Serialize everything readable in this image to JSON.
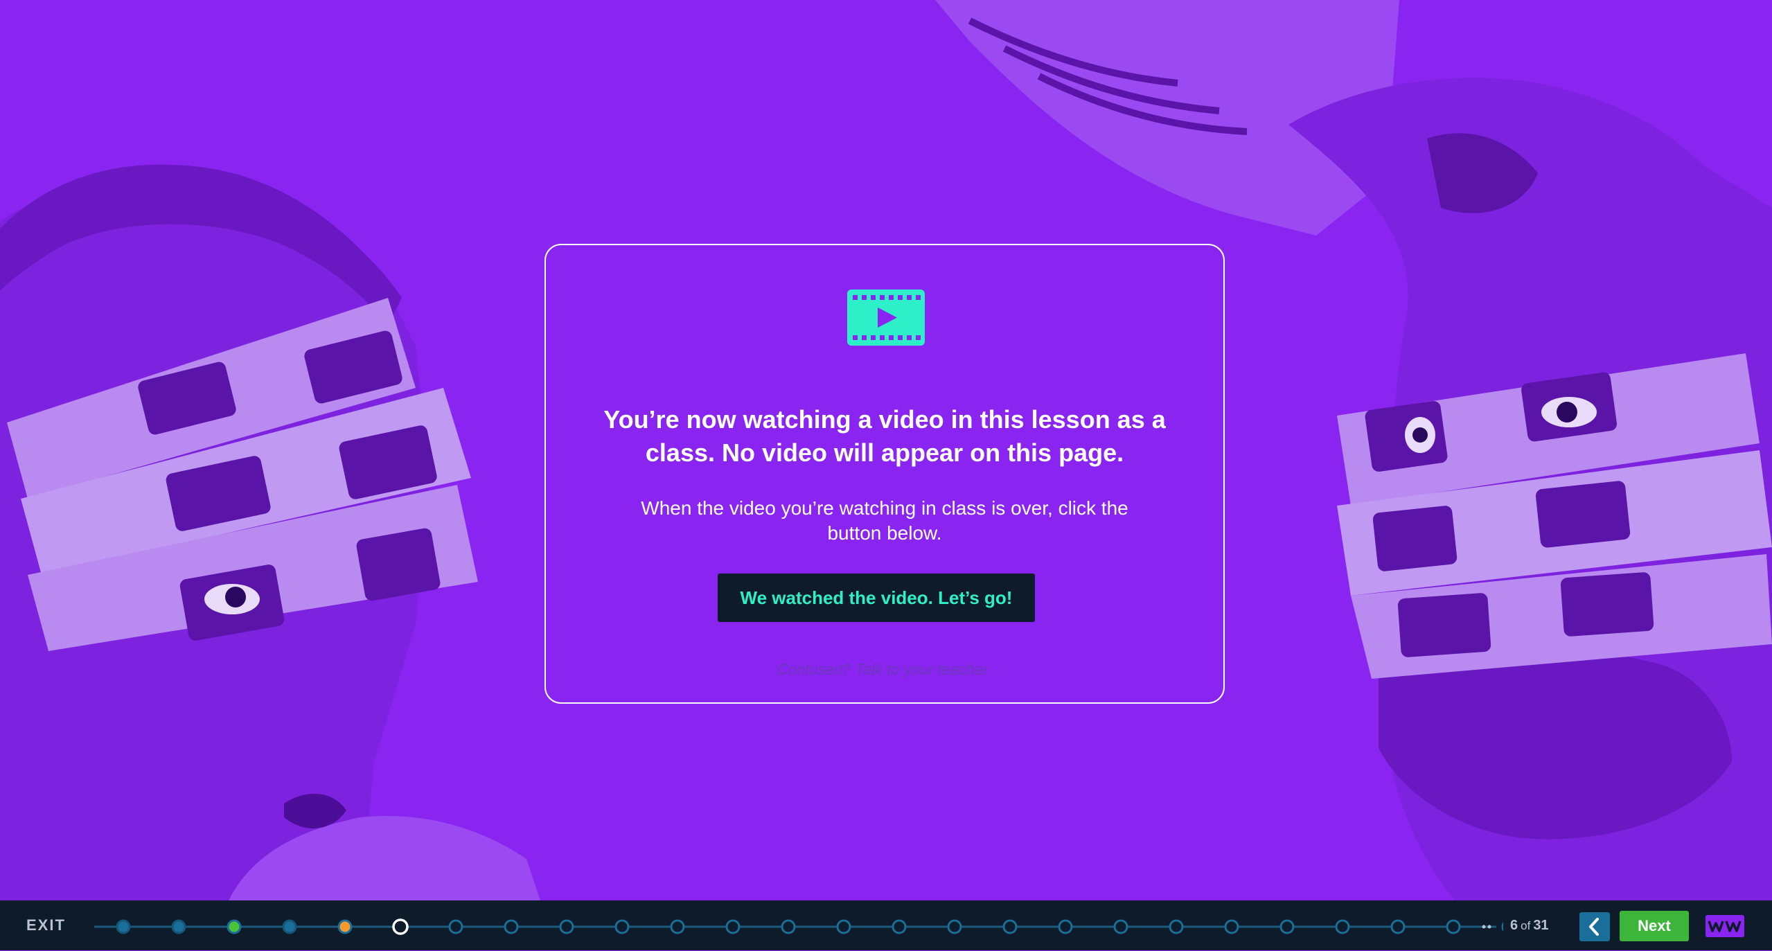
{
  "lesson_card": {
    "title": "You’re now watching a video in this lesson as a class. No video will appear on this page.",
    "body": "When the video you’re watching in class is over, click the button below.",
    "button_label": "We watched the video. Let’s go!",
    "help_text": "Confused? Talk to your teacher.",
    "icon": "video-film-icon"
  },
  "navbar": {
    "exit_label": "EXIT",
    "page_current": "6",
    "page_of": "of",
    "page_total": "31",
    "next_label": "Next",
    "back_icon": "chevron-left-icon",
    "logo_text": "WW",
    "progress_steps": [
      "visited",
      "visited",
      "complete",
      "visited",
      "review",
      "current",
      "pending",
      "pending",
      "pending",
      "pending",
      "pending",
      "pending",
      "pending",
      "pending",
      "pending",
      "pending",
      "pending",
      "pending",
      "pending",
      "pending",
      "pending",
      "pending",
      "pending",
      "pending",
      "pending",
      "pending"
    ]
  },
  "colors": {
    "background": "#8a24f0",
    "navbar": "#0e1b2a",
    "accent_teal": "#2df0c8",
    "next_green": "#3db53a",
    "back_blue": "#1a6e9a",
    "step_complete": "#4cc43a",
    "step_review": "#f59a2e",
    "step_visited": "#1a6e9a"
  }
}
